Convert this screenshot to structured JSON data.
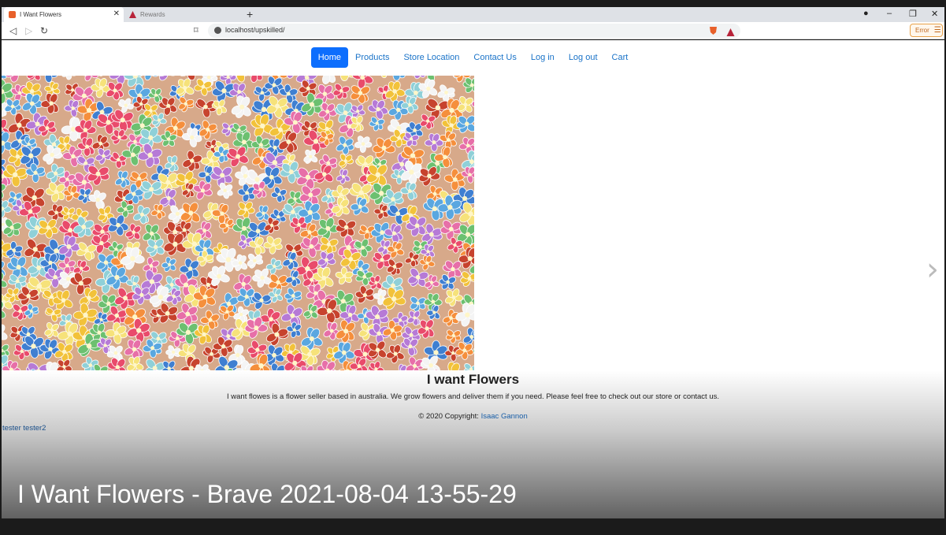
{
  "browser": {
    "tabs": [
      {
        "title": "I Want Flowers",
        "active": true,
        "favicon_color": "#e8602a"
      },
      {
        "title": "Rewards",
        "active": false,
        "favicon_color": "#b8243a"
      }
    ],
    "new_tab": "+",
    "url": "localhost/upskilled/",
    "error_label": "Error",
    "window_controls": {
      "minimize": "–",
      "restore": "❐",
      "close": "✕"
    }
  },
  "nav": {
    "items": [
      "Home",
      "Products",
      "Store Location",
      "Contact Us",
      "Log in",
      "Log out",
      "Cart"
    ],
    "active_index": 0,
    "accent": "#0d6efd"
  },
  "carousel": {
    "next_icon": "›"
  },
  "content": {
    "heading": "I want Flowers",
    "description": "I want flowes is a flower seller based in australia. We grow flowers and deliver them if you need. Please feel free to check out our store or contact us.",
    "copyright_prefix": "© 2020 Copyright: ",
    "copyright_name": "Isaac Gannon",
    "user": "tester tester2"
  },
  "caption": "I Want Flowers - Brave 2021-08-04 13-55-29"
}
